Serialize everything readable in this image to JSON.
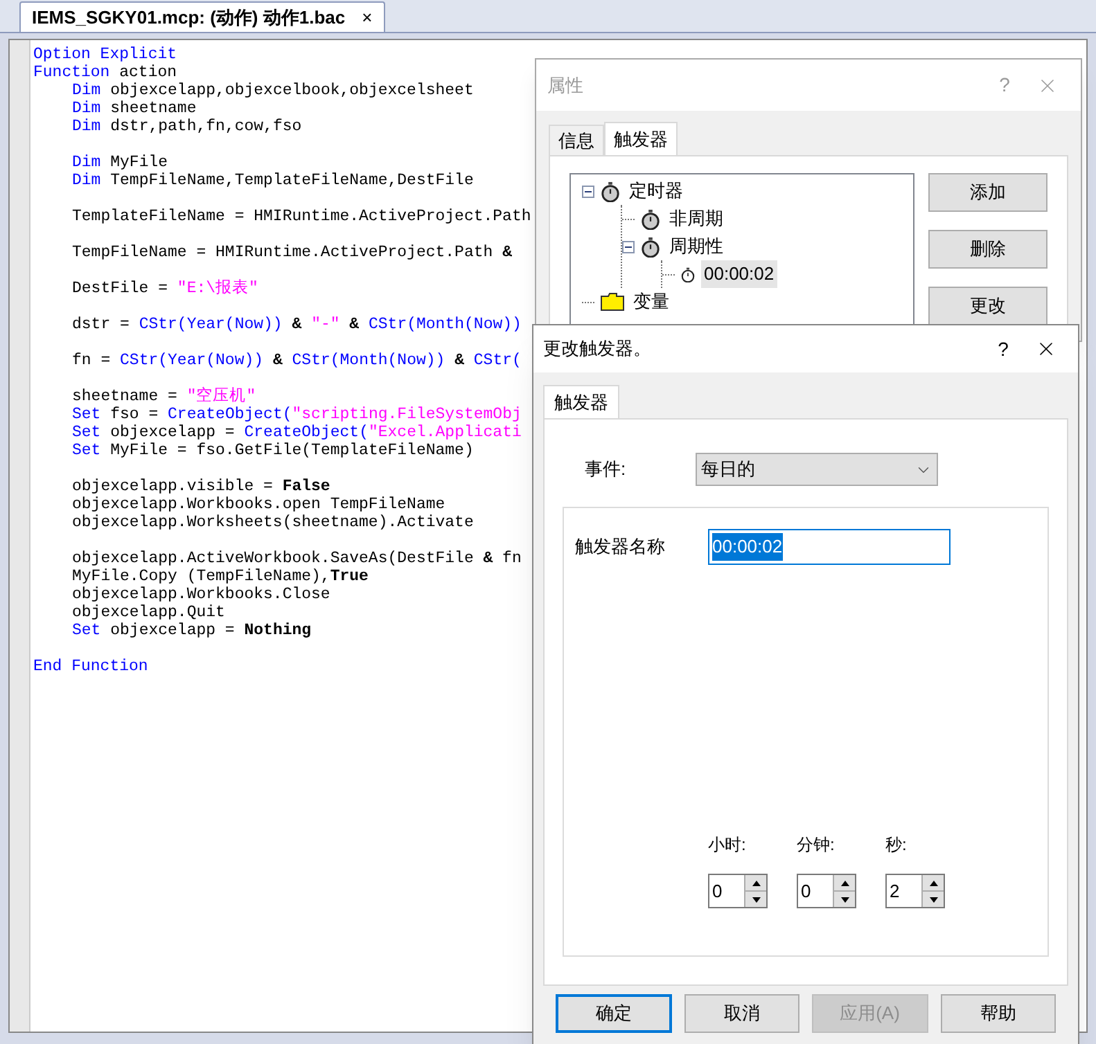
{
  "editor": {
    "tab": {
      "title": "IEMS_SGKY01.mcp: (动作) 动作1.bac",
      "close": "×"
    },
    "lines": [
      {
        "kind": "code",
        "indented": false,
        "segments": [
          {
            "kind": "keyword",
            "text": "Option Explicit"
          }
        ]
      },
      {
        "kind": "code",
        "indented": false,
        "segments": [
          {
            "kind": "keyword",
            "text": "Function"
          },
          {
            "kind": "plain",
            "text": " action"
          }
        ]
      },
      {
        "kind": "code",
        "indented": true,
        "segments": [
          {
            "kind": "keyword",
            "text": "Dim"
          },
          {
            "kind": "plain",
            "text": " objexcelapp,objexcelbook,objexcelsheet"
          }
        ]
      },
      {
        "kind": "code",
        "indented": true,
        "segments": [
          {
            "kind": "keyword",
            "text": "Dim"
          },
          {
            "kind": "plain",
            "text": " sheetname"
          }
        ]
      },
      {
        "kind": "code",
        "indented": true,
        "segments": [
          {
            "kind": "keyword",
            "text": "Dim"
          },
          {
            "kind": "plain",
            "text": " dstr,path,fn,cow,fso"
          }
        ]
      },
      {
        "kind": "blank"
      },
      {
        "kind": "code",
        "indented": true,
        "segments": [
          {
            "kind": "keyword",
            "text": "Dim"
          },
          {
            "kind": "plain",
            "text": " MyFile"
          }
        ]
      },
      {
        "kind": "code",
        "indented": true,
        "segments": [
          {
            "kind": "keyword",
            "text": "Dim"
          },
          {
            "kind": "plain",
            "text": " TempFileName,TemplateFileName,DestFile"
          }
        ]
      },
      {
        "kind": "blank"
      },
      {
        "kind": "code",
        "indented": true,
        "segments": [
          {
            "kind": "plain",
            "text": "TemplateFileName = HMIRuntime.ActiveProject.Path"
          }
        ]
      },
      {
        "kind": "blank"
      },
      {
        "kind": "code",
        "indented": true,
        "segments": [
          {
            "kind": "plain",
            "text": "TempFileName = HMIRuntime.ActiveProject.Path "
          },
          {
            "kind": "bold",
            "text": "&"
          }
        ]
      },
      {
        "kind": "blank"
      },
      {
        "kind": "code",
        "indented": true,
        "segments": [
          {
            "kind": "plain",
            "text": "DestFile = "
          },
          {
            "kind": "string",
            "text": "\"E:\\报表\""
          }
        ]
      },
      {
        "kind": "blank"
      },
      {
        "kind": "code",
        "indented": true,
        "segments": [
          {
            "kind": "plain",
            "text": "dstr = "
          },
          {
            "kind": "keyword",
            "text": "CStr(Year(Now))"
          },
          {
            "kind": "bold",
            "text": " & "
          },
          {
            "kind": "string",
            "text": "\"-\""
          },
          {
            "kind": "bold",
            "text": " & "
          },
          {
            "kind": "keyword",
            "text": "CStr(Month(Now))"
          }
        ]
      },
      {
        "kind": "blank"
      },
      {
        "kind": "code",
        "indented": true,
        "segments": [
          {
            "kind": "plain",
            "text": "fn = "
          },
          {
            "kind": "keyword",
            "text": "CStr(Year(Now))"
          },
          {
            "kind": "bold",
            "text": " & "
          },
          {
            "kind": "keyword",
            "text": "CStr(Month(Now))"
          },
          {
            "kind": "bold",
            "text": " & "
          },
          {
            "kind": "keyword",
            "text": "CStr("
          }
        ]
      },
      {
        "kind": "blank"
      },
      {
        "kind": "code",
        "indented": true,
        "segments": [
          {
            "kind": "plain",
            "text": "sheetname = "
          },
          {
            "kind": "string",
            "text": "\"空压机\""
          }
        ]
      },
      {
        "kind": "code",
        "indented": true,
        "segments": [
          {
            "kind": "keyword",
            "text": "Set"
          },
          {
            "kind": "plain",
            "text": " fso = "
          },
          {
            "kind": "keyword",
            "text": "CreateObject("
          },
          {
            "kind": "string",
            "text": "\"scripting.FileSystemObj"
          }
        ]
      },
      {
        "kind": "code",
        "indented": true,
        "segments": [
          {
            "kind": "keyword",
            "text": "Set"
          },
          {
            "kind": "plain",
            "text": " objexcelapp = "
          },
          {
            "kind": "keyword",
            "text": "CreateObject("
          },
          {
            "kind": "string",
            "text": "\"Excel.Applicati"
          }
        ]
      },
      {
        "kind": "code",
        "indented": true,
        "segments": [
          {
            "kind": "keyword",
            "text": "Set"
          },
          {
            "kind": "plain",
            "text": " MyFile = fso.GetFile(TemplateFileName)"
          }
        ]
      },
      {
        "kind": "blank"
      },
      {
        "kind": "code",
        "indented": true,
        "segments": [
          {
            "kind": "plain",
            "text": "objexcelapp.visible = "
          },
          {
            "kind": "bold",
            "text": "False"
          }
        ]
      },
      {
        "kind": "code",
        "indented": true,
        "segments": [
          {
            "kind": "plain",
            "text": "objexcelapp.Workbooks.open TempFileName"
          }
        ]
      },
      {
        "kind": "code",
        "indented": true,
        "segments": [
          {
            "kind": "plain",
            "text": "objexcelapp.Worksheets(sheetname).Activate"
          }
        ]
      },
      {
        "kind": "blank"
      },
      {
        "kind": "code",
        "indented": true,
        "segments": [
          {
            "kind": "plain",
            "text": "objexcelapp.ActiveWorkbook.SaveAs(DestFile "
          },
          {
            "kind": "bold",
            "text": "&"
          },
          {
            "kind": "plain",
            "text": " fn"
          }
        ]
      },
      {
        "kind": "code",
        "indented": true,
        "segments": [
          {
            "kind": "plain",
            "text": "MyFile.Copy (TempFileName),"
          },
          {
            "kind": "bold",
            "text": "True"
          }
        ]
      },
      {
        "kind": "code",
        "indented": true,
        "segments": [
          {
            "kind": "plain",
            "text": "objexcelapp.Workbooks.Close"
          }
        ]
      },
      {
        "kind": "code",
        "indented": true,
        "segments": [
          {
            "kind": "plain",
            "text": "objexcelapp.Quit"
          }
        ]
      },
      {
        "kind": "code",
        "indented": true,
        "segments": [
          {
            "kind": "keyword",
            "text": "Set"
          },
          {
            "kind": "plain",
            "text": " objexcelapp = "
          },
          {
            "kind": "bold",
            "text": "Nothing"
          }
        ]
      },
      {
        "kind": "blank"
      },
      {
        "kind": "code",
        "indented": false,
        "segments": [
          {
            "kind": "keyword",
            "text": "End Function"
          }
        ]
      }
    ]
  },
  "properties_dialog": {
    "title": "属性",
    "help": "?",
    "tabs": [
      {
        "label": "信息",
        "selected": false
      },
      {
        "label": "触发器",
        "selected": true
      }
    ],
    "tree": [
      {
        "label": "定时器",
        "kind": "timer",
        "expanded": true,
        "selected": false,
        "children": [
          {
            "label": "非周期",
            "kind": "timer",
            "selected": false
          },
          {
            "label": "周期性",
            "kind": "timer",
            "expanded": true,
            "selected": false,
            "children": [
              {
                "label": "00:00:02",
                "kind": "small-timer",
                "selected": true
              }
            ]
          }
        ]
      },
      {
        "label": "变量",
        "kind": "folder",
        "selected": false
      }
    ],
    "buttons": [
      "添加",
      "删除",
      "更改"
    ]
  },
  "trigger_dialog": {
    "title": "更改触发器。",
    "help": "?",
    "tabs": [
      {
        "label": "触发器",
        "selected": true
      }
    ],
    "event": {
      "label": "事件:",
      "value": "每日的"
    },
    "name": {
      "label": "触发器名称",
      "value": "00:00:02"
    },
    "time_fields": [
      {
        "label": "小时:",
        "value": "0"
      },
      {
        "label": "分钟:",
        "value": "0"
      },
      {
        "label": "秒:",
        "value": "2"
      }
    ],
    "buttons": [
      {
        "label": "确定",
        "default": true,
        "disabled": false
      },
      {
        "label": "取消",
        "default": false,
        "disabled": false
      },
      {
        "label": "应用(A)",
        "default": false,
        "disabled": true
      },
      {
        "label": "帮助",
        "default": false,
        "disabled": false
      }
    ]
  }
}
